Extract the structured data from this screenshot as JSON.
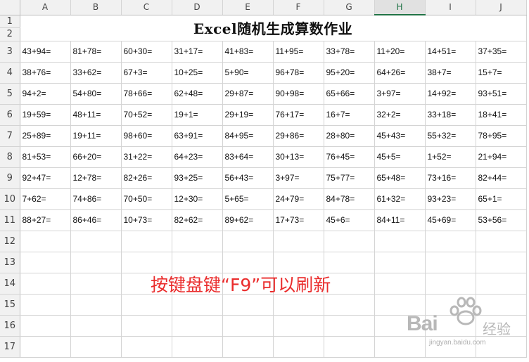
{
  "sheet": {
    "columns": [
      "A",
      "B",
      "C",
      "D",
      "E",
      "F",
      "G",
      "H",
      "I",
      "J"
    ],
    "active_column": "H",
    "rows": [
      "1",
      "2",
      "3",
      "4",
      "5",
      "6",
      "7",
      "8",
      "9",
      "10",
      "11",
      "12",
      "13",
      "14",
      "15",
      "16",
      "17"
    ],
    "title": "Excel随机生成算数作业",
    "problems": [
      [
        "43+94=",
        "81+78=",
        "60+30=",
        "31+17=",
        "41+83=",
        "11+95=",
        "33+78=",
        "11+20=",
        "14+51=",
        "37+35="
      ],
      [
        "38+76=",
        "33+62=",
        "67+3=",
        "10+25=",
        "5+90=",
        "96+78=",
        "95+20=",
        "64+26=",
        "38+7=",
        "15+7="
      ],
      [
        "94+2=",
        "54+80=",
        "78+66=",
        "62+48=",
        "29+87=",
        "90+98=",
        "65+66=",
        "3+97=",
        "14+92=",
        "93+51="
      ],
      [
        "19+59=",
        "48+11=",
        "70+52=",
        "19+1=",
        "29+19=",
        "76+17=",
        "16+7=",
        "32+2=",
        "33+18=",
        "18+41="
      ],
      [
        "25+89=",
        "19+11=",
        "98+60=",
        "63+91=",
        "84+95=",
        "29+86=",
        "28+80=",
        "45+43=",
        "55+32=",
        "78+95="
      ],
      [
        "81+53=",
        "66+20=",
        "31+22=",
        "64+23=",
        "83+64=",
        "30+13=",
        "76+45=",
        "45+5=",
        "1+52=",
        "21+94="
      ],
      [
        "92+47=",
        "12+78=",
        "82+26=",
        "93+25=",
        "56+43=",
        "3+97=",
        "75+77=",
        "65+48=",
        "73+16=",
        "82+44="
      ],
      [
        "7+62=",
        "74+86=",
        "70+50=",
        "12+30=",
        "5+65=",
        "24+79=",
        "84+78=",
        "61+32=",
        "93+23=",
        "65+1="
      ],
      [
        "88+27=",
        "86+46=",
        "10+73=",
        "82+62=",
        "89+62=",
        "17+73=",
        "45+6=",
        "84+11=",
        "45+69=",
        "53+56="
      ]
    ]
  },
  "overlay": {
    "instruction": "按键盘键“F9”可以刷新",
    "color": "#ea2c2c"
  },
  "watermark": {
    "brand": "Bai",
    "brand_suffix": "经验",
    "url": "jingyan.baidu.com",
    "paw_icon": "baidu-paw-icon"
  },
  "colors": {
    "header_bg": "#f1f1f1",
    "active_header": "#217346",
    "gridline": "#d4d4d4"
  }
}
